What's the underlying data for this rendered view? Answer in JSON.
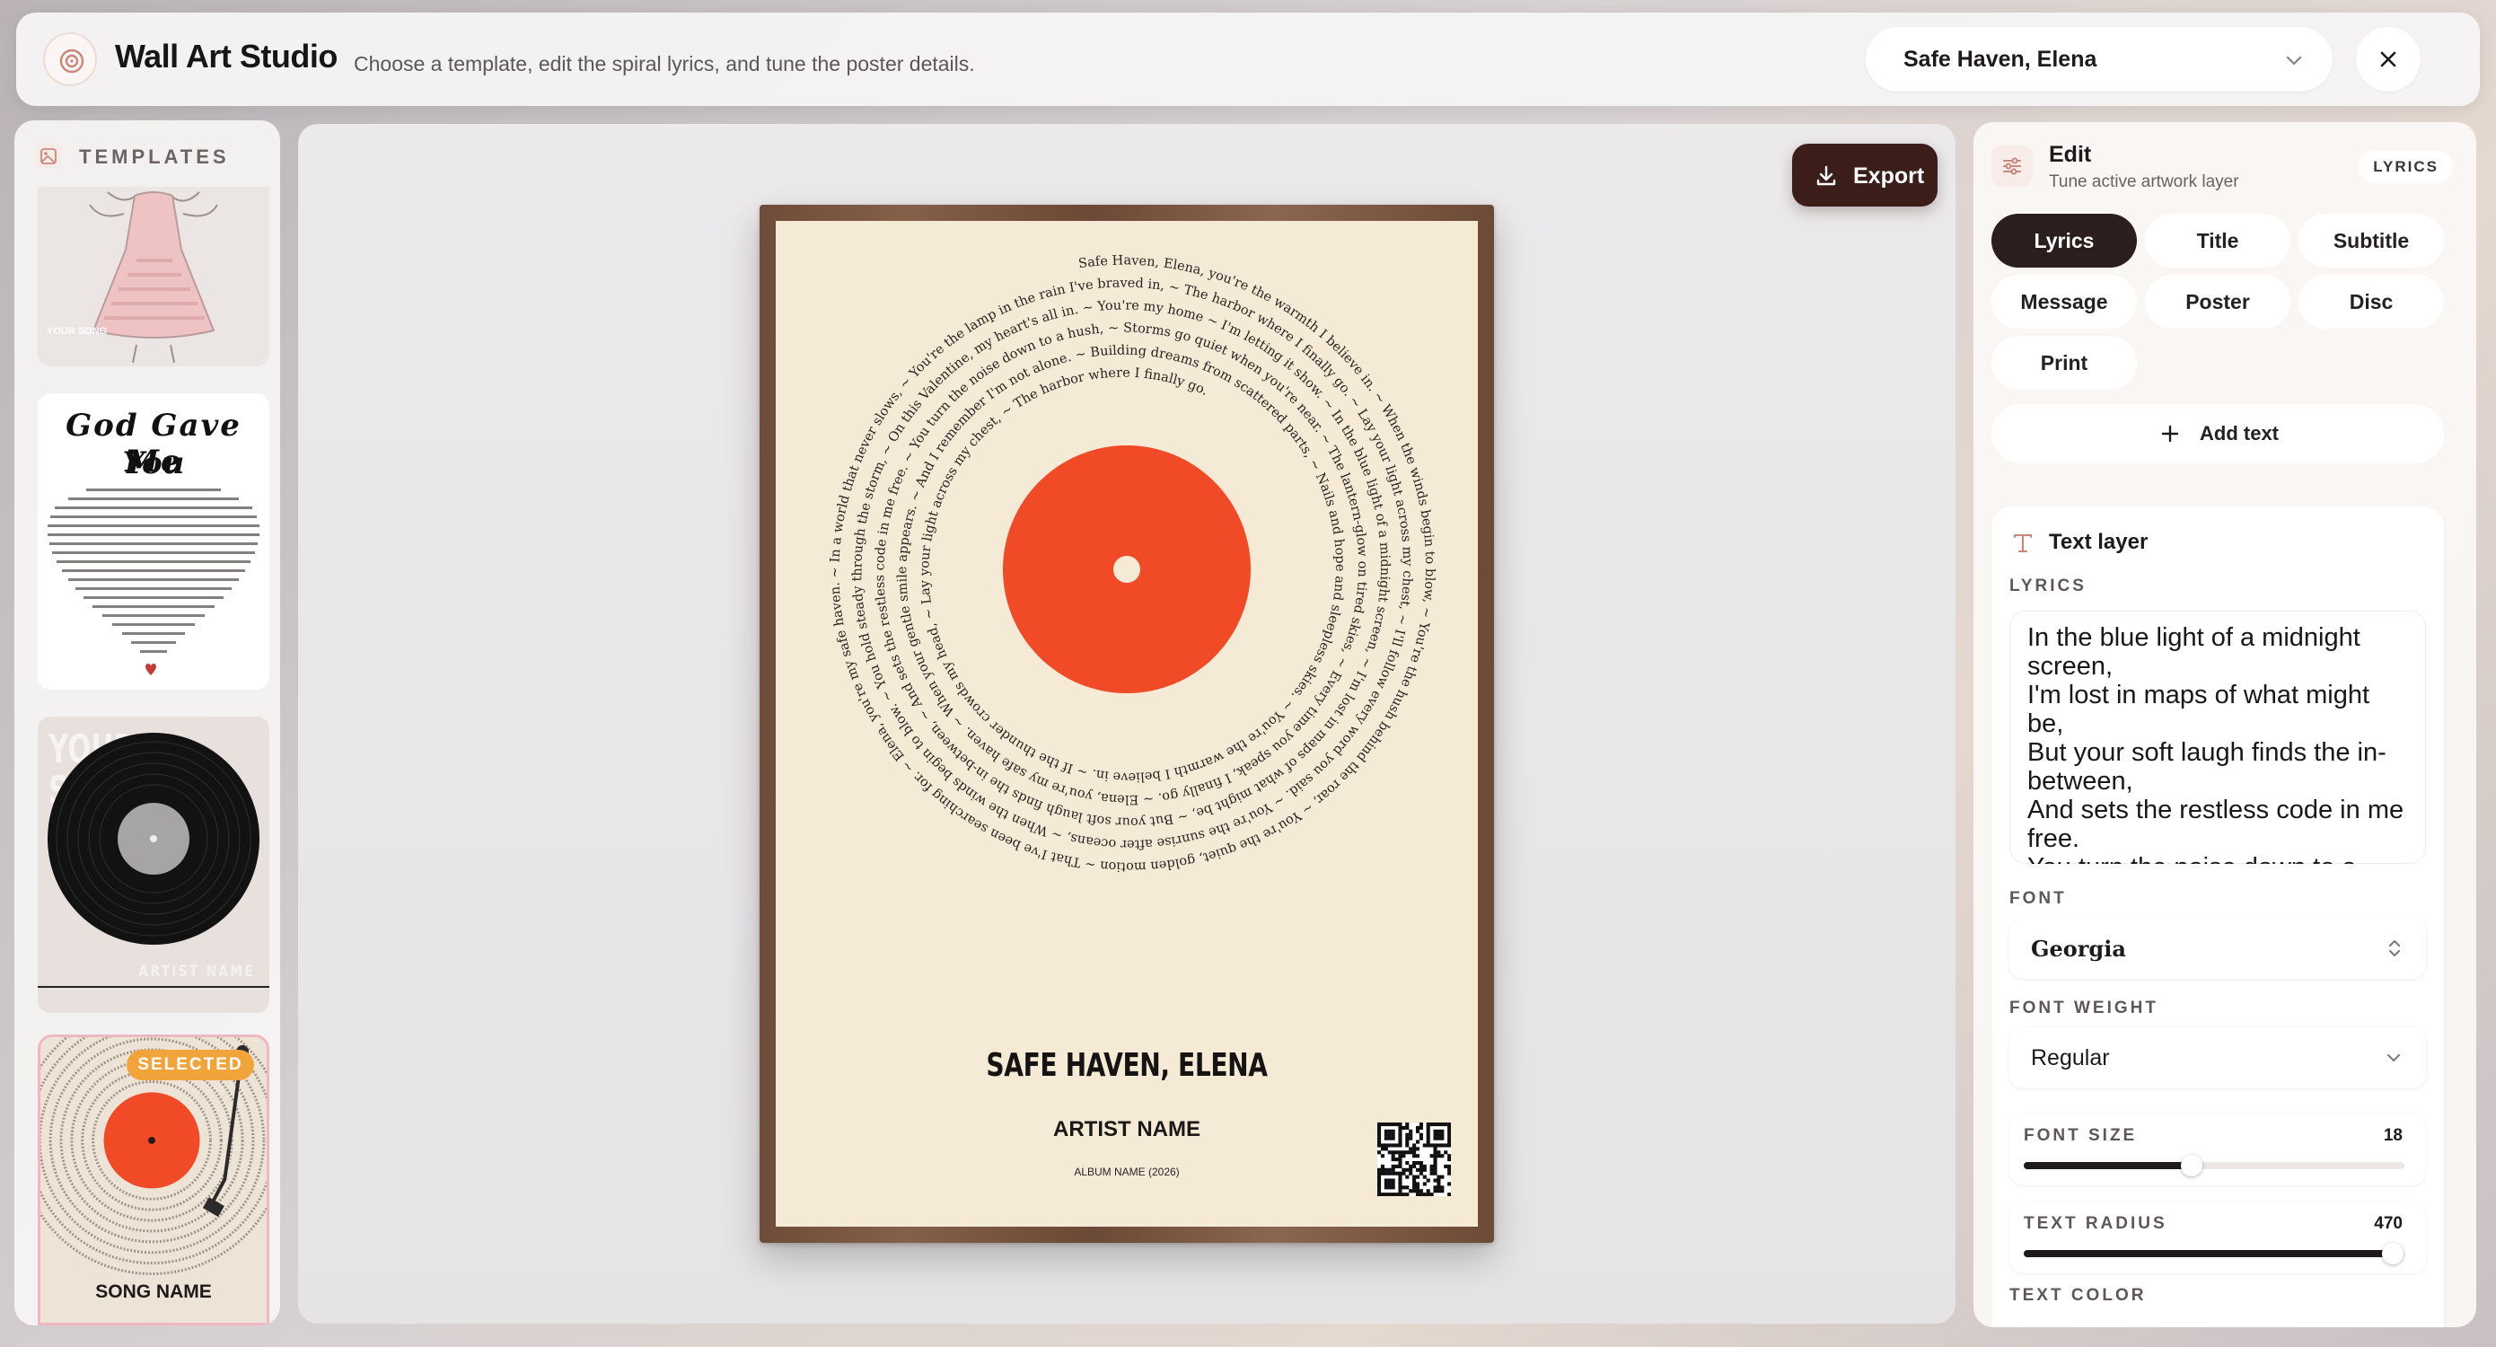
{
  "header": {
    "title": "Wall Art Studio",
    "subtitle": "Choose a template, edit the spiral lyrics, and tune the poster details.",
    "song_select": "Safe Haven, Elena"
  },
  "templates": {
    "heading": "TEMPLATES",
    "items": [
      {
        "caption": "YOUR SONG"
      },
      {
        "title_line1": "God Gave Me",
        "title_line2": "You"
      },
      {
        "title_line1": "YOUR",
        "title_line2": "SONG",
        "footer": "ARTIST NAME"
      },
      {
        "badge": "SELECTED",
        "caption": "SONG NAME"
      }
    ]
  },
  "canvas": {
    "export_label": "Export",
    "poster": {
      "title": "SAFE HAVEN, ELENA",
      "artist": "ARTIST NAME",
      "album": "ALBUM NAME (2026)",
      "spiral_text": "Safe Haven, Elena, you're the warmth I believe in. ~ When the winds begin to blow, ~ You're the hush behind the roar, ~ You're the quiet, golden motion ~ That I've been searching for. ~ Elena, you're my safe haven. ~ In a world that never slows, ~ You're the lamp in the rain I've braved in, ~ The harbor where I finally go. ~ Lay your light across my chest, ~ I'll follow every word you said. ~ You're the sunrise after oceans, ~ When the winds begin to blow. ~ You hold steady through the storm, ~ On this Valentine, my heart's all in. ~ You're my home ~ I'm letting it show. ~ In the blue light of a midnight screen, ~ I'm lost in maps of what might be, ~ But your soft laugh finds the in-between, ~ And sets the restless code in me free. ~ You turn the noise down to a hush, ~ Storms go quiet when you're near. ~ The lantern-glow on tired skies, ~ Every time you speak, I finally go. ~ Elena, you're my safe haven. ~ When your gentle smile appears. ~ And I remember I'm not alone. ~ Building dreams from scattered parts, ~ Nails and hope and sleepless skies. ~ You're the warmth I believe in. ~ If the thunder crowds my head, ~ Lay your light across my chest, ~ The harbor where I finally go.",
      "disc_color": "#f04a26",
      "paper_color": "#f4ead6"
    }
  },
  "edit": {
    "title": "Edit",
    "subtitle": "Tune active artwork layer",
    "badge": "LYRICS",
    "tabs": [
      "Lyrics",
      "Title",
      "Subtitle",
      "Message",
      "Poster",
      "Disc",
      "Print"
    ],
    "active_tab": "Lyrics",
    "add_text_label": "Add text",
    "layer": {
      "heading": "Text layer",
      "lyrics_label": "LYRICS",
      "lyrics_lines": [
        "In the blue light of a midnight screen,",
        "I'm lost in maps of what might be,",
        "But your soft laugh finds the in-between,",
        "And sets the restless code in me free.",
        "You turn the noise down to a hush,"
      ],
      "font_label": "FONT",
      "font_value": "Georgia",
      "weight_label": "FONT WEIGHT",
      "weight_value": "Regular",
      "font_size_label": "FONT SIZE",
      "font_size_value": "18",
      "font_size_fraction": 0.44,
      "radius_label": "TEXT RADIUS",
      "radius_value": "470",
      "radius_fraction": 0.97,
      "color_label": "TEXT COLOR"
    }
  }
}
